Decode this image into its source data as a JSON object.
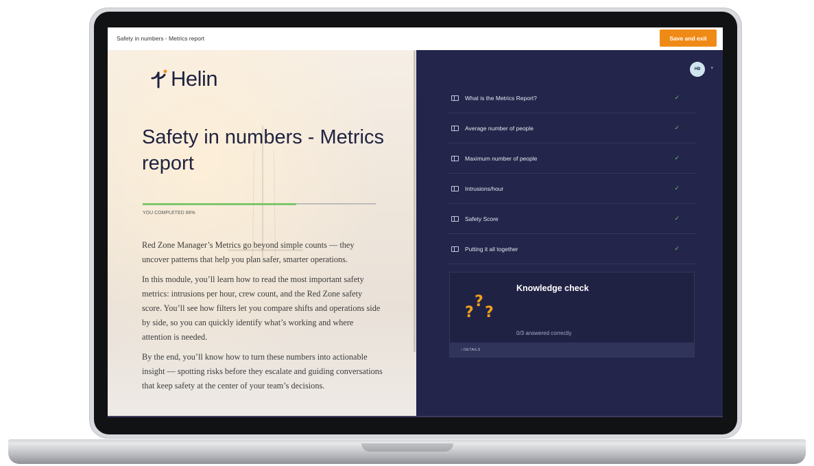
{
  "app": {
    "document_title": "Safety in numbers - Metrics report",
    "save_exit_label": "Save and exit",
    "brand_color": "#f08a16"
  },
  "left": {
    "logo_text": "Helin",
    "title": "Safety in numbers - Metrics report",
    "progress": {
      "percent": 66,
      "label": "YOU COMPLETED 66%"
    },
    "paragraphs": [
      "Red Zone Manager’s Metrics go beyond simple counts — they uncover patterns that help you plan safer, smarter operations.",
      "In this module, you’ll learn how to read the most important safety metrics: intrusions per hour, crew count, and the Red Zone safety score. You’ll see how filters let you compare shifts and operations side by side, so you can quickly identify what’s working and where attention is needed.",
      "By the end, you’ll know how to turn these numbers into actionable insight — spotting risks before they escalate and guiding conversations that keep safety at the center of your team’s decisions."
    ]
  },
  "right": {
    "avatar_initials": "HB",
    "lessons": [
      {
        "label": "What is the Metrics Report?",
        "icon": "lesson-icon",
        "status": "complete"
      },
      {
        "label": "Average number of people",
        "icon": "lesson-icon",
        "status": "complete"
      },
      {
        "label": "Maximum number of people",
        "icon": "lesson-icon",
        "status": "complete"
      },
      {
        "label": "Intrusions/hour",
        "icon": "lesson-icon",
        "status": "complete"
      },
      {
        "label": "Safety Score",
        "icon": "lesson-icon",
        "status": "complete"
      },
      {
        "label": "Putting it all together",
        "icon": "lesson-icon",
        "status": "complete"
      }
    ],
    "check_mark": "✓",
    "knowledge_check": {
      "title": "Knowledge check",
      "subtitle": "0/3 answered correctly",
      "details_label": "› DETAILS",
      "icon": "question-marks-icon"
    },
    "panel_color": "#23254a",
    "check_color": "#6fc26d"
  }
}
